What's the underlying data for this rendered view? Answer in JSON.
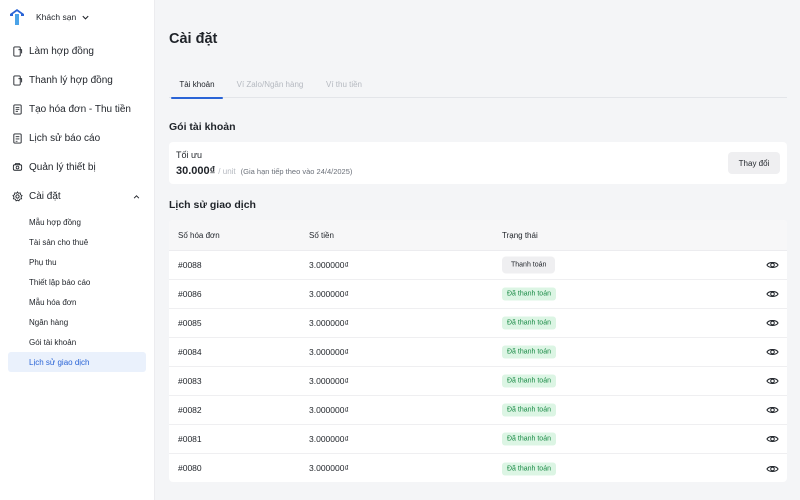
{
  "brand": {
    "name": "Khách sạn"
  },
  "nav": [
    {
      "label": "Làm hợp đồng",
      "icon": "contract-icon"
    },
    {
      "label": "Thanh lý hợp đồng",
      "icon": "contract-liquidation-icon"
    },
    {
      "label": "Tạo hóa đơn - Thu tiền",
      "icon": "invoice-icon"
    },
    {
      "label": "Lịch sử báo cáo",
      "icon": "report-history-icon"
    },
    {
      "label": "Quản lý thiết bị",
      "icon": "device-icon"
    },
    {
      "label": "Cài đặt",
      "icon": "gear-icon"
    }
  ],
  "settings_sub": [
    "Mẫu hợp đồng",
    "Tài sản cho thuê",
    "Phụ thu",
    "Thiết lập báo cáo",
    "Mẫu hóa đơn",
    "Ngân hàng",
    "Gói tài khoản",
    "Lịch sử giao dịch"
  ],
  "active_sub": "Lịch sử giao dịch",
  "page": {
    "title": "Cài đặt"
  },
  "tabs": [
    {
      "label": "Tài khoản",
      "active": true
    },
    {
      "label": "Ví Zalo/Ngân hàng",
      "active": false
    },
    {
      "label": "Ví thu tiền",
      "active": false
    }
  ],
  "plan": {
    "heading": "Gói tài khoản",
    "name": "Tối ưu",
    "price": "30.000₫",
    "unit": "/ unit",
    "renewal": "(Gia hạn tiếp theo vào 24/4/2025)",
    "change_label": "Thay đổi"
  },
  "transactions": {
    "heading": "Lịch sử giao dịch",
    "columns": [
      "Số hóa đơn",
      "Số tiền",
      "Trạng thái"
    ],
    "rows": [
      {
        "invoice": "#0088",
        "amount": "3.000000₫",
        "status": "Thanh toán",
        "status_type": "pay"
      },
      {
        "invoice": "#0086",
        "amount": "3.000000₫",
        "status": "Đã thanh toán",
        "status_type": "paid"
      },
      {
        "invoice": "#0085",
        "amount": "3.000000₫",
        "status": "Đã thanh toán",
        "status_type": "paid"
      },
      {
        "invoice": "#0084",
        "amount": "3.000000₫",
        "status": "Đã thanh toán",
        "status_type": "paid"
      },
      {
        "invoice": "#0083",
        "amount": "3.000000₫",
        "status": "Đã thanh toán",
        "status_type": "paid"
      },
      {
        "invoice": "#0082",
        "amount": "3.000000₫",
        "status": "Đã thanh toán",
        "status_type": "paid"
      },
      {
        "invoice": "#0081",
        "amount": "3.000000₫",
        "status": "Đã thanh toán",
        "status_type": "paid"
      },
      {
        "invoice": "#0080",
        "amount": "3.000000₫",
        "status": "Đã thanh toán",
        "status_type": "paid"
      }
    ],
    "row_action_icon": "eye-icon"
  },
  "colors": {
    "accent": "#2a64d6",
    "paid_bg": "#dcf5e4",
    "paid_text": "#1a8a46"
  }
}
